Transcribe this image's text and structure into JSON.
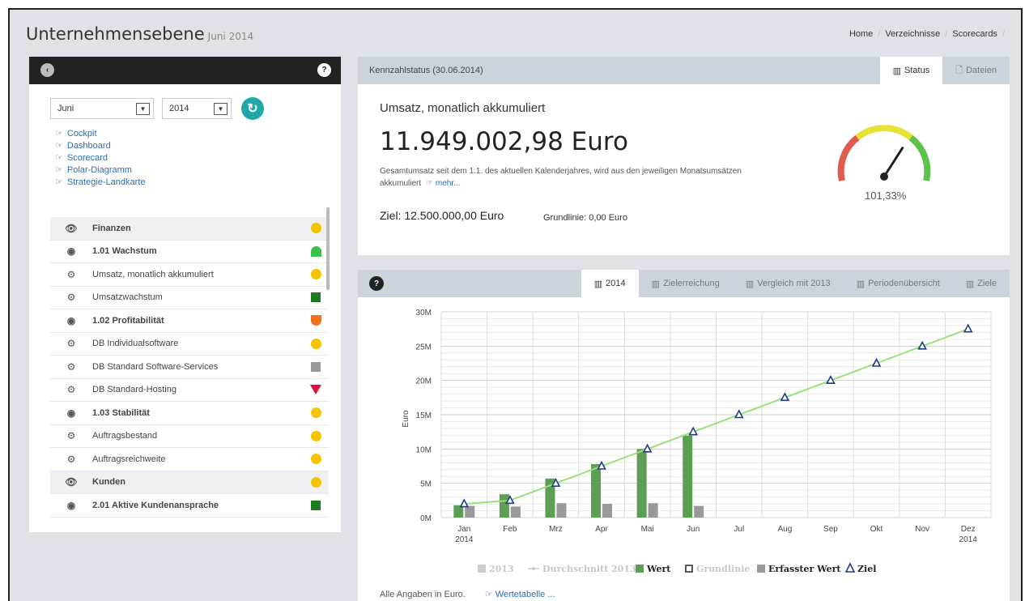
{
  "header": {
    "title": "Unternehmensebene",
    "subtitle": "Juni 2014",
    "breadcrumb": [
      "Home",
      "Verzeichnisse",
      "Scorecards"
    ]
  },
  "left": {
    "month_value": "Juni",
    "year_value": "2014",
    "links": [
      "Cockpit",
      "Dashboard",
      "Scorecard",
      "Polar-Diagramm",
      "Strategie-Landkarte"
    ],
    "tree": [
      {
        "label": "Finanzen",
        "type": "group",
        "status": "dot",
        "color": "#f5c400"
      },
      {
        "label": "1.01 Wachstum",
        "type": "bold",
        "status": "semi",
        "color": "#3cc04b"
      },
      {
        "label": "Umsatz, monatlich akkumuliert",
        "type": "kpi",
        "status": "dot",
        "color": "#f5c400"
      },
      {
        "label": "Umsatzwachstum",
        "type": "kpi",
        "status": "sq",
        "color": "#1e7a1e"
      },
      {
        "label": "1.02 Profitabilität",
        "type": "bold",
        "status": "shield",
        "color": "#f07020"
      },
      {
        "label": "DB Individualsoftware",
        "type": "kpi",
        "status": "dot",
        "color": "#f5c400"
      },
      {
        "label": "DB Standard Software-Services",
        "type": "kpi",
        "status": "sq",
        "color": "#999999"
      },
      {
        "label": "DB Standard-Hosting",
        "type": "kpi",
        "status": "tri",
        "color": "#e0103a"
      },
      {
        "label": "1.03 Stabilität",
        "type": "bold",
        "status": "dot",
        "color": "#f5c400"
      },
      {
        "label": "Auftragsbestand",
        "type": "kpi",
        "status": "dot",
        "color": "#f5c400"
      },
      {
        "label": "Auftragsreichweite",
        "type": "kpi",
        "status": "dot",
        "color": "#f5c400"
      },
      {
        "label": "Kunden",
        "type": "group",
        "status": "dot",
        "color": "#f5c400"
      },
      {
        "label": "2.01 Aktive Kundenansprache",
        "type": "bold",
        "status": "sq",
        "color": "#1e7a1e"
      }
    ]
  },
  "status": {
    "head_title": "Kennzahlstatus (30.06.2014)",
    "tab_status": "Status",
    "tab_files": "Dateien",
    "kpi_name": "Umsatz, monatlich akkumuliert",
    "kpi_value": "11.949.002,98 Euro",
    "kpi_desc": "Gesamtumsatz seit dem 1.1. des aktuellen Kalenderjahres, wird aus den jeweiligen Monatsumsätzen akkumuliert",
    "more": "mehr...",
    "goal": "Ziel: 12.500.000,00 Euro",
    "baseline": "Grundlinie: 0,00 Euro",
    "gauge_pct": "101,33%",
    "gauge_ratio": 1.0133
  },
  "chart_tabs": [
    "2014",
    "Zielerreichung",
    "Vergleich mit 2013",
    "Periodenübersicht",
    "Ziele"
  ],
  "chart_note": "Alle Angaben in Euro.",
  "chart_link": "Wertetabelle ...",
  "chart_data": {
    "type": "bar",
    "categories": [
      "Jan",
      "Feb",
      "Mrz",
      "Apr",
      "Mai",
      "Jun",
      "Jul",
      "Aug",
      "Sep",
      "Okt",
      "Nov",
      "Dez"
    ],
    "category_sublabels": {
      "0": "2014",
      "11": "2014"
    },
    "ylabel": "Euro",
    "ylim": [
      0,
      30000000
    ],
    "yticks": [
      "0M",
      "5M",
      "10M",
      "15M",
      "20M",
      "25M",
      "30M"
    ],
    "series": [
      {
        "name": "Wert",
        "kind": "bar",
        "color": "#5d9e55",
        "values": [
          1800000,
          3400000,
          5700000,
          7800000,
          10000000,
          11949003,
          null,
          null,
          null,
          null,
          null,
          null
        ]
      },
      {
        "name": "Erfasster Wert",
        "kind": "bar",
        "color": "#999999",
        "values": [
          1700000,
          1600000,
          2100000,
          2000000,
          2100000,
          1700000,
          null,
          null,
          null,
          null,
          null,
          null
        ]
      },
      {
        "name": "Ziel",
        "kind": "line-marker",
        "color": "#1f3c8f",
        "line_color": "#9be07a",
        "values": [
          2000000,
          2500000,
          5000000,
          7500000,
          10000000,
          12500000,
          15000000,
          17500000,
          20000000,
          22500000,
          25000000,
          27500000
        ]
      }
    ],
    "legend": [
      {
        "name": "2013",
        "color": "#cccccc",
        "symbol": "square",
        "active": false
      },
      {
        "name": "Durchschnitt 2013",
        "color": "#cccccc",
        "symbol": "line",
        "active": false
      },
      {
        "name": "Wert",
        "color": "#5d9e55",
        "symbol": "square",
        "active": true
      },
      {
        "name": "Grundlinie",
        "color": "#aaaaaa",
        "symbol": "hollow",
        "active": false
      },
      {
        "name": "Erfasster Wert",
        "color": "#999999",
        "symbol": "square",
        "active": true
      },
      {
        "name": "Ziel",
        "color": "#1f3c8f",
        "symbol": "triangle",
        "active": true
      }
    ]
  }
}
